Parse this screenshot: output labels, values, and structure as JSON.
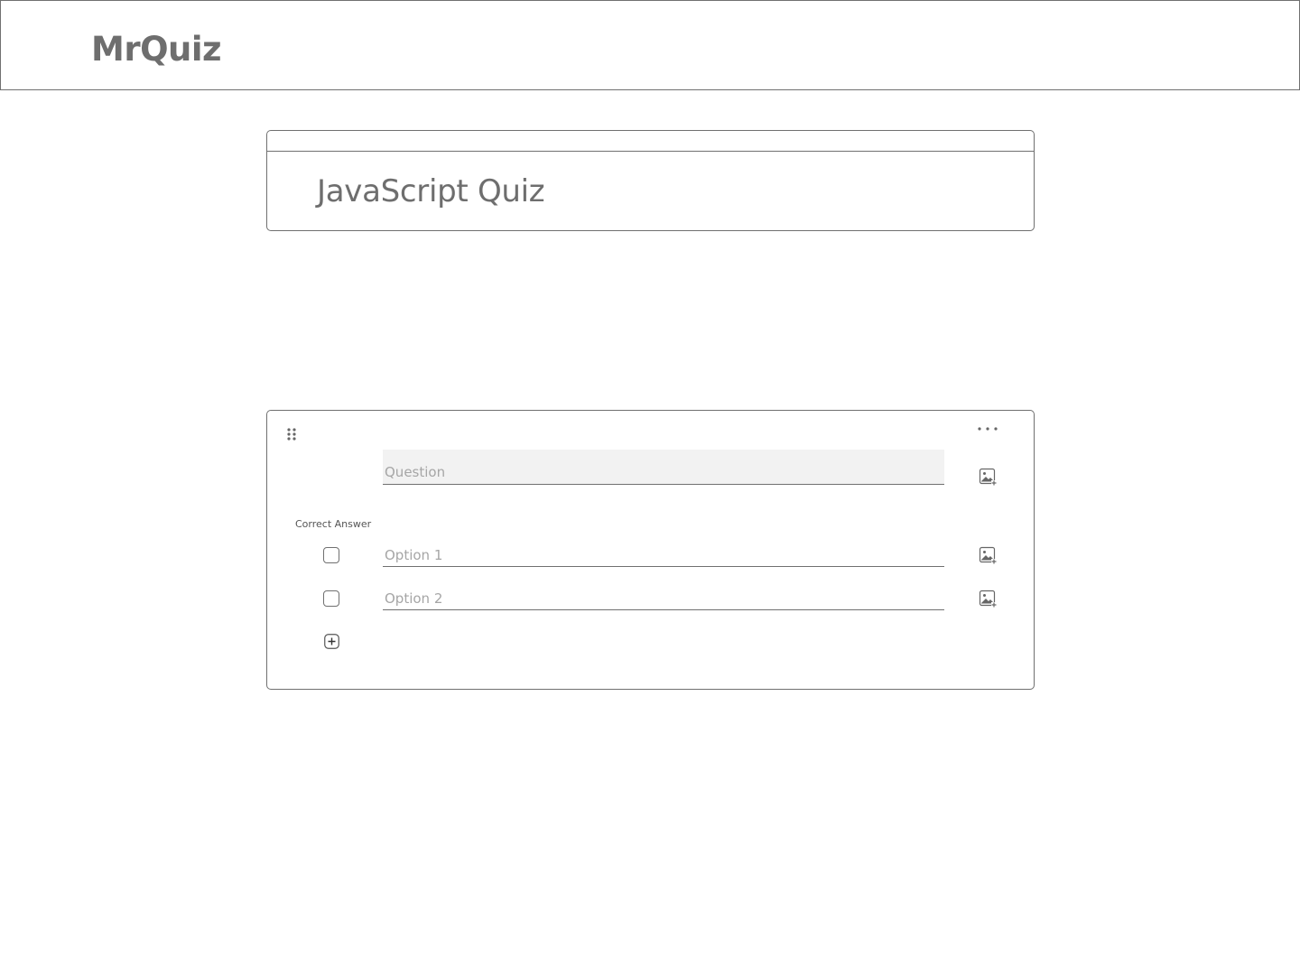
{
  "header": {
    "brand": "MrQuiz"
  },
  "quiz": {
    "title": "JavaScript Quiz"
  },
  "question_card": {
    "question_placeholder": "Question",
    "correct_answer_label": "Correct Answer",
    "options": [
      {
        "placeholder": "Option 1",
        "checked": false
      },
      {
        "placeholder": "Option 2",
        "checked": false
      }
    ]
  },
  "icons": {
    "drag": "drag-handle-icon",
    "more": "more-horizontal-icon",
    "image": "add-image-icon",
    "add": "add-option-icon"
  },
  "colors": {
    "border": "#707070",
    "text": "#6e6e6e",
    "question_fill": "#f2f2f2",
    "placeholder": "#a6a6a6"
  }
}
